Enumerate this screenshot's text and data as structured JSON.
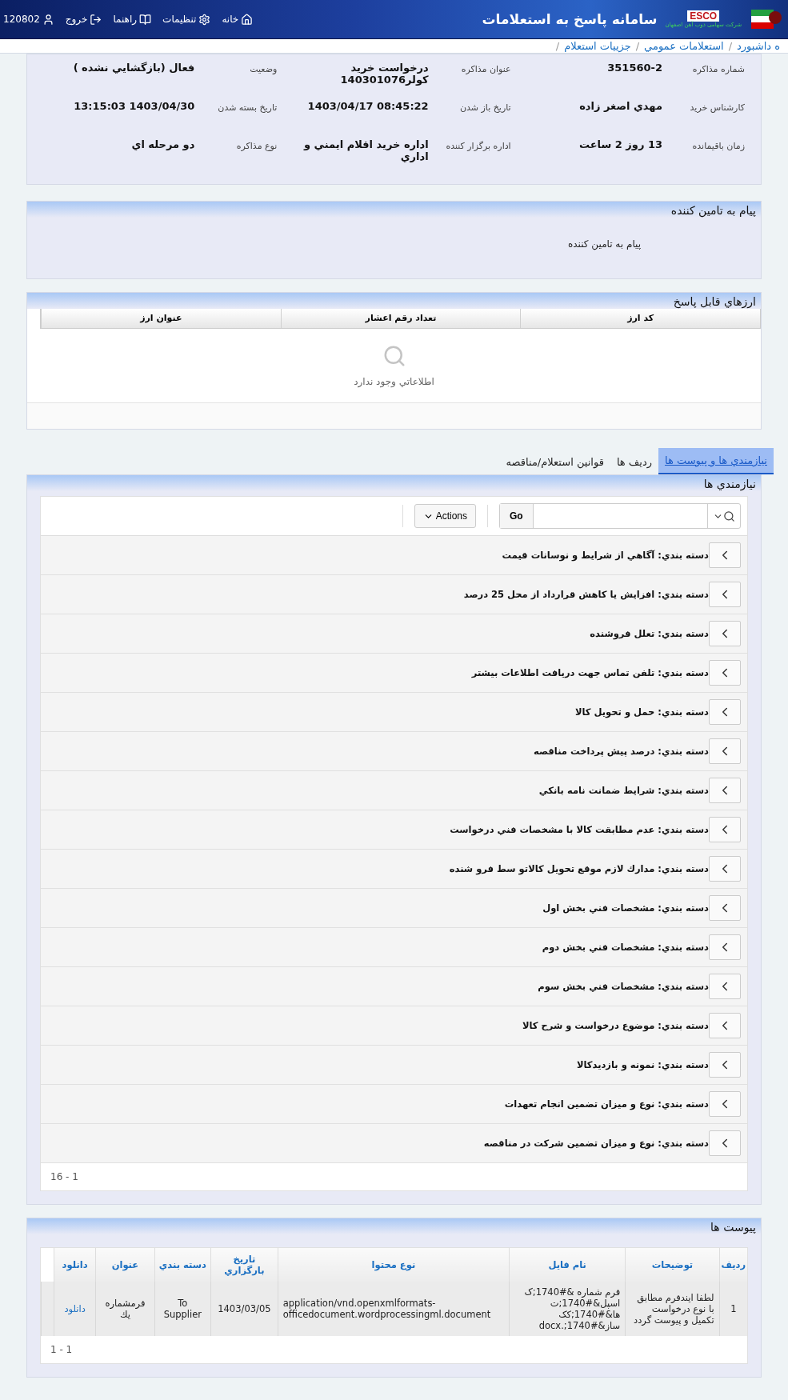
{
  "header": {
    "title": "سامانه پاسخ به استعلامات",
    "logo_text": "ESCO",
    "logo_subtitle": "شرکت سهامی ذوب آهن اصفهان",
    "nav": [
      {
        "kind": "home",
        "label": "خانه"
      },
      {
        "kind": "settings",
        "label": "تنظيمات"
      },
      {
        "kind": "help",
        "label": "راهنما"
      },
      {
        "kind": "logout",
        "label": "خروج"
      },
      {
        "kind": "user",
        "label": "120802"
      }
    ]
  },
  "breadcrumb": [
    "ه داشبورد",
    "استعلامات عمومي",
    "جزييات استعلام"
  ],
  "breadcrumb_separator": "/",
  "details": [
    [
      {
        "label": "شماره مذاكره",
        "value": "351560-2"
      },
      {
        "label": "عنوان مذاكره",
        "value": "درخواست خريد كولر140301076"
      },
      {
        "label": "وضعيت",
        "value": "فعال (بازگشايي نشده )"
      }
    ],
    [
      {
        "label": "كارشناس خريد",
        "value": "مهدي اصغر زاده"
      },
      {
        "label": "تاريخ باز شدن",
        "value": "08:45:22 1403/04/17"
      },
      {
        "label": "تاريخ بسته شدن",
        "value": "1403/04/30 13:15:03"
      }
    ],
    [
      {
        "label": "زمان باقيمانده",
        "value": "13 روز 2 ساعت"
      },
      {
        "label": "اداره برگزار كننده",
        "value": "اداره خريد اقلام ايمني و اداري"
      },
      {
        "label": "نوع مذاكره",
        "value": "دو مرحله اي"
      }
    ]
  ],
  "supplier_message": {
    "title": "پيام به تامين كننده",
    "text": "پيام به تامين كننده"
  },
  "currencies": {
    "title": "ارزهاي قابل پاسخ",
    "columns": [
      "كد ارز",
      "تعداد رقم اعشار",
      "عنوان ارز"
    ],
    "empty_text": "اطلاعاتي وجود ندارد"
  },
  "tabs": [
    {
      "label": "نيازمندي ها و پيوست ها",
      "selected": true
    },
    {
      "label": "رديف ها",
      "selected": false
    },
    {
      "label": "قوانين استعلام/مناقصه",
      "selected": false
    }
  ],
  "requirements": {
    "title": "نيازمندي ها",
    "go_label": "Go",
    "actions_label": "Actions",
    "pagination": "16 - 1",
    "groups": [
      "دسته بندي: آگاهي از شرايط و نوسانات قيمت",
      "دسته بندي: افزايش يا كاهش قرارداد از محل 25 درصد",
      "دسته بندي: تعلل فروشنده",
      "دسته بندي: تلفن تماس جهت دريافت اطلاعات بيشتر",
      "دسته بندي: حمل و تحويل كالا",
      "دسته بندي: درصد پيش پرداخت مناقصه",
      "دسته بندي: شرايط ضمانت نامه بانكي",
      "دسته بندي: عدم مطابقت كالا با مشخصات فني درخواست",
      "دسته بندي: مدارك لازم موقع تحويل كالاتو سط فرو شنده",
      "دسته بندي: مشخصات فني بخش اول",
      "دسته بندي: مشخصات فني بخش دوم",
      "دسته بندي: مشخصات فني بخش سوم",
      "دسته بندي: موضوع درخواست و شرح كالا",
      "دسته بندي: نمونه و بازديدكالا",
      "دسته بندي: نوع و ميزان تضمين انجام تعهدات",
      "دسته بندي: نوع و ميزان تضمين شركت در مناقصه"
    ]
  },
  "attachments": {
    "title": "پيوست ها",
    "columns": [
      "رديف",
      "توضيحات",
      "نام فايل",
      "نوع محتوا",
      "تاريخ بارگزاري",
      "دسته بندي",
      "عنوان",
      "دانلود"
    ],
    "rows": [
      [
        "1",
        "لطفا ايندفرم مطابق با نوع درخواست تكميل و پيوست گردد",
        "فرم شماره &#1740;ک اسپل&#1740;ت ها&#1740;کک ساز&#1740;.docx",
        "application/vnd.openxmlformats-officedocument.wordprocessingml.document",
        "1403/03/05",
        "To Supplier",
        "فرمشماره يك",
        "دانلود"
      ]
    ],
    "pagination": "1 - 1"
  }
}
